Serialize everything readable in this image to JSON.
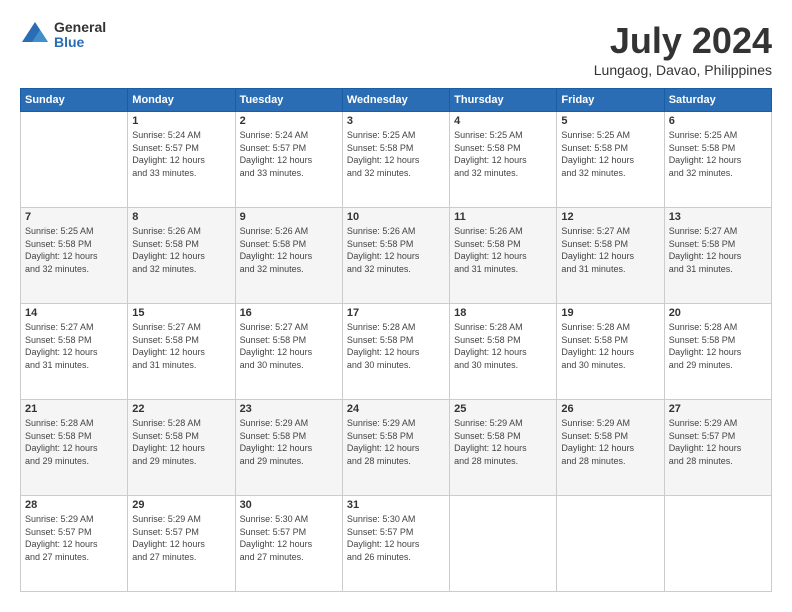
{
  "logo": {
    "general": "General",
    "blue": "Blue"
  },
  "header": {
    "month": "July 2024",
    "location": "Lungaog, Davao, Philippines"
  },
  "weekdays": [
    "Sunday",
    "Monday",
    "Tuesday",
    "Wednesday",
    "Thursday",
    "Friday",
    "Saturday"
  ],
  "weeks": [
    [
      {
        "day": "",
        "info": ""
      },
      {
        "day": "1",
        "info": "Sunrise: 5:24 AM\nSunset: 5:57 PM\nDaylight: 12 hours\nand 33 minutes."
      },
      {
        "day": "2",
        "info": "Sunrise: 5:24 AM\nSunset: 5:57 PM\nDaylight: 12 hours\nand 33 minutes."
      },
      {
        "day": "3",
        "info": "Sunrise: 5:25 AM\nSunset: 5:58 PM\nDaylight: 12 hours\nand 32 minutes."
      },
      {
        "day": "4",
        "info": "Sunrise: 5:25 AM\nSunset: 5:58 PM\nDaylight: 12 hours\nand 32 minutes."
      },
      {
        "day": "5",
        "info": "Sunrise: 5:25 AM\nSunset: 5:58 PM\nDaylight: 12 hours\nand 32 minutes."
      },
      {
        "day": "6",
        "info": "Sunrise: 5:25 AM\nSunset: 5:58 PM\nDaylight: 12 hours\nand 32 minutes."
      }
    ],
    [
      {
        "day": "7",
        "info": "Sunrise: 5:25 AM\nSunset: 5:58 PM\nDaylight: 12 hours\nand 32 minutes."
      },
      {
        "day": "8",
        "info": "Sunrise: 5:26 AM\nSunset: 5:58 PM\nDaylight: 12 hours\nand 32 minutes."
      },
      {
        "day": "9",
        "info": "Sunrise: 5:26 AM\nSunset: 5:58 PM\nDaylight: 12 hours\nand 32 minutes."
      },
      {
        "day": "10",
        "info": "Sunrise: 5:26 AM\nSunset: 5:58 PM\nDaylight: 12 hours\nand 32 minutes."
      },
      {
        "day": "11",
        "info": "Sunrise: 5:26 AM\nSunset: 5:58 PM\nDaylight: 12 hours\nand 31 minutes."
      },
      {
        "day": "12",
        "info": "Sunrise: 5:27 AM\nSunset: 5:58 PM\nDaylight: 12 hours\nand 31 minutes."
      },
      {
        "day": "13",
        "info": "Sunrise: 5:27 AM\nSunset: 5:58 PM\nDaylight: 12 hours\nand 31 minutes."
      }
    ],
    [
      {
        "day": "14",
        "info": "Sunrise: 5:27 AM\nSunset: 5:58 PM\nDaylight: 12 hours\nand 31 minutes."
      },
      {
        "day": "15",
        "info": "Sunrise: 5:27 AM\nSunset: 5:58 PM\nDaylight: 12 hours\nand 31 minutes."
      },
      {
        "day": "16",
        "info": "Sunrise: 5:27 AM\nSunset: 5:58 PM\nDaylight: 12 hours\nand 30 minutes."
      },
      {
        "day": "17",
        "info": "Sunrise: 5:28 AM\nSunset: 5:58 PM\nDaylight: 12 hours\nand 30 minutes."
      },
      {
        "day": "18",
        "info": "Sunrise: 5:28 AM\nSunset: 5:58 PM\nDaylight: 12 hours\nand 30 minutes."
      },
      {
        "day": "19",
        "info": "Sunrise: 5:28 AM\nSunset: 5:58 PM\nDaylight: 12 hours\nand 30 minutes."
      },
      {
        "day": "20",
        "info": "Sunrise: 5:28 AM\nSunset: 5:58 PM\nDaylight: 12 hours\nand 29 minutes."
      }
    ],
    [
      {
        "day": "21",
        "info": "Sunrise: 5:28 AM\nSunset: 5:58 PM\nDaylight: 12 hours\nand 29 minutes."
      },
      {
        "day": "22",
        "info": "Sunrise: 5:28 AM\nSunset: 5:58 PM\nDaylight: 12 hours\nand 29 minutes."
      },
      {
        "day": "23",
        "info": "Sunrise: 5:29 AM\nSunset: 5:58 PM\nDaylight: 12 hours\nand 29 minutes."
      },
      {
        "day": "24",
        "info": "Sunrise: 5:29 AM\nSunset: 5:58 PM\nDaylight: 12 hours\nand 28 minutes."
      },
      {
        "day": "25",
        "info": "Sunrise: 5:29 AM\nSunset: 5:58 PM\nDaylight: 12 hours\nand 28 minutes."
      },
      {
        "day": "26",
        "info": "Sunrise: 5:29 AM\nSunset: 5:58 PM\nDaylight: 12 hours\nand 28 minutes."
      },
      {
        "day": "27",
        "info": "Sunrise: 5:29 AM\nSunset: 5:57 PM\nDaylight: 12 hours\nand 28 minutes."
      }
    ],
    [
      {
        "day": "28",
        "info": "Sunrise: 5:29 AM\nSunset: 5:57 PM\nDaylight: 12 hours\nand 27 minutes."
      },
      {
        "day": "29",
        "info": "Sunrise: 5:29 AM\nSunset: 5:57 PM\nDaylight: 12 hours\nand 27 minutes."
      },
      {
        "day": "30",
        "info": "Sunrise: 5:30 AM\nSunset: 5:57 PM\nDaylight: 12 hours\nand 27 minutes."
      },
      {
        "day": "31",
        "info": "Sunrise: 5:30 AM\nSunset: 5:57 PM\nDaylight: 12 hours\nand 26 minutes."
      },
      {
        "day": "",
        "info": ""
      },
      {
        "day": "",
        "info": ""
      },
      {
        "day": "",
        "info": ""
      }
    ]
  ]
}
